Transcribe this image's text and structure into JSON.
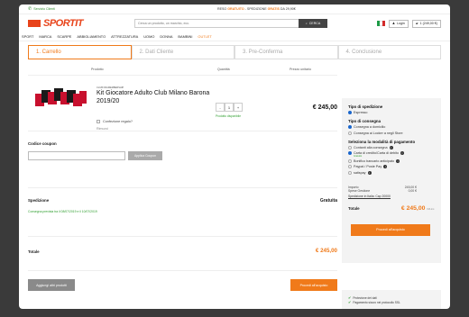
{
  "topbar": {
    "service_label": "Servizio Clienti",
    "promo_prefix": "RESO",
    "promo_free1": "GRATUITO",
    "promo_middle": "- SPEDIZIONE",
    "promo_free2": "GRATIS",
    "promo_suffix": "DA 29,90€"
  },
  "header": {
    "logo_text": "SPORTIT",
    "search_placeholder": "Cerca un prodotto, un marchio, ecc.",
    "search_button": "CERCA",
    "login_label": "Login",
    "cart_label": "1 (249,00 €)"
  },
  "nav": [
    "SPORT",
    "MARCA",
    "SCARPE",
    "ABBIGLIAMENTO",
    "ATTREZZATURA",
    "UOMO",
    "DONNA",
    "BAMBINI"
  ],
  "nav_outlet": "OUTLET",
  "steps": [
    "1. Carrello",
    "2. Dati Cliente",
    "3. Pre-Conferma",
    "4. Conclusione"
  ],
  "table": {
    "col_product": "Prodotto",
    "col_qty": "Quantità",
    "col_price": "Prezzo unitario"
  },
  "product": {
    "brand": "CLUB FRAMEMBERSHIP",
    "name": "Kit Giocatore Adulto Club Milano Barona 2019/20",
    "gift_label": "Confezione regalo?",
    "remove_label": "Rimuovi",
    "qty": "1",
    "minus": "-",
    "plus": "+",
    "availability": "Prodotto disponibile",
    "price": "€ 245,00"
  },
  "coupon": {
    "label": "Codice coupon",
    "apply": "Applica Coupon"
  },
  "shipping": {
    "label": "Spedizione",
    "delivery": "Consegna prevista tra il 08/07/2019 e il 10/07/2019",
    "value": "Gratuita"
  },
  "total": {
    "label": "Totale",
    "value": "€ 245,00"
  },
  "actions": {
    "add_more": "Aggiungi altri prodotti",
    "proceed": "Procedi all'acquisto"
  },
  "sidebar": {
    "ship_type_title": "Tipo di spedizione",
    "ship_type_opts": [
      "Espresso"
    ],
    "delivery_type_title": "Tipo di consegna",
    "delivery_opts": [
      "Consegna a domicilio",
      "Consegna ai Locker a negli Store"
    ],
    "payment_title": "Seleziona la modalità di pagamento",
    "payment_opts": [
      "Contanti alla consegna",
      "Carta di credito/Carta di debito",
      "Bonifico bancario anticipato",
      "Paypal / Poste Pay",
      "satispay"
    ],
    "payment_free": "Gratuito",
    "amount_label": "Importo",
    "amount_value": "245,00 €",
    "fee_label": "Spese Gestione",
    "fee_value": "0,00 €",
    "ship_link": "Spedizione in Italia: Cap 20000",
    "total_label": "Totale",
    "total_value": "€ 245,00",
    "iva": "IVA inc.",
    "proceed": "Procedi all'acquisto"
  },
  "sidebar2": {
    "line1": "Protezione dei dati",
    "line2": "Pagamento sicuro nei protocollo SSL"
  },
  "colors": {
    "accent": "#f07a1a",
    "green": "#2e9e2e",
    "logo_red": "#e8431a"
  }
}
